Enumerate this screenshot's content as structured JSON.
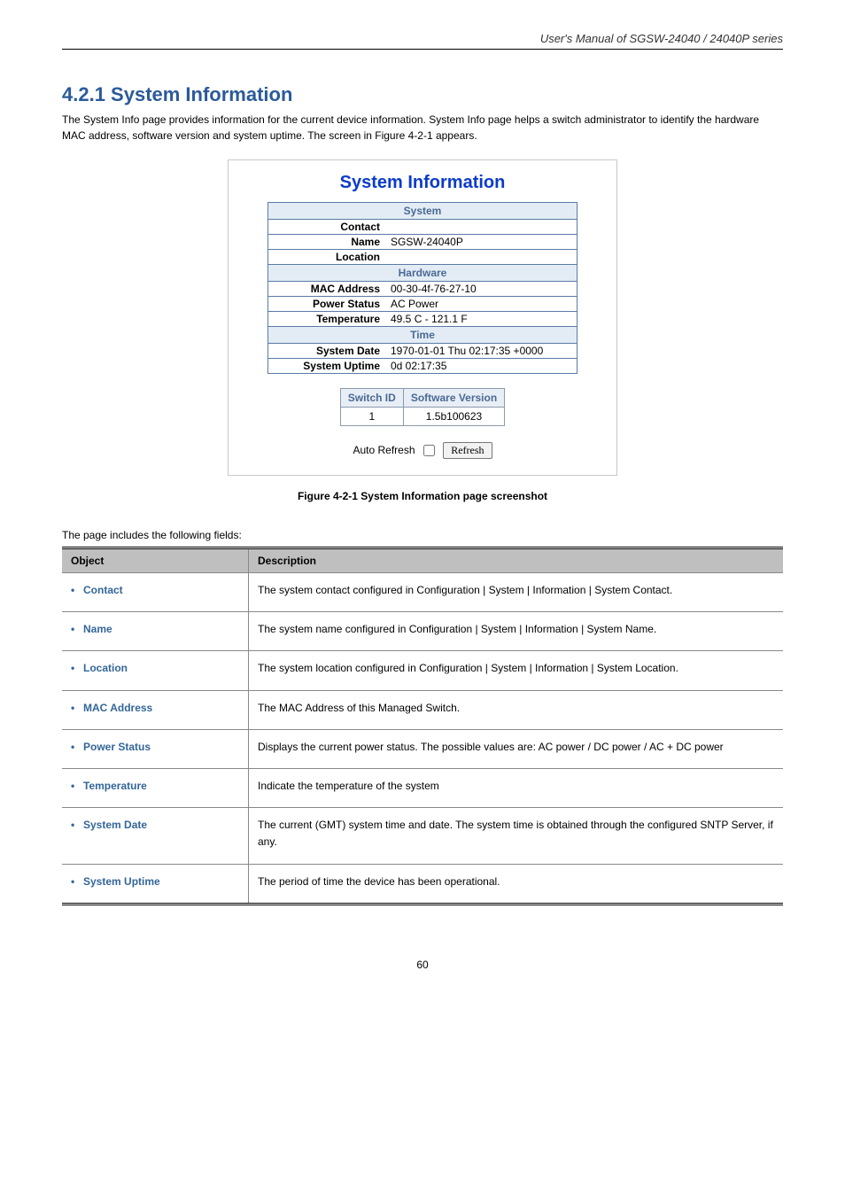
{
  "header": {
    "manual": "User's Manual of SGSW-24040 / 24040P series"
  },
  "section": {
    "title": "4.2.1 System Information",
    "intro": "The System Info page provides information for the current device information. System Info page helps a switch administrator to identify the hardware MAC address, software version and system uptime. The screen in Figure 4-2-1 appears."
  },
  "screenshot": {
    "heading": "System Information",
    "group_system": "System",
    "contact_label": "Contact",
    "contact_value": "",
    "name_label": "Name",
    "name_value": "SGSW-24040P",
    "location_label": "Location",
    "location_value": "",
    "group_hardware": "Hardware",
    "mac_label": "MAC Address",
    "mac_value": "00-30-4f-76-27-10",
    "power_label": "Power Status",
    "power_value": "AC Power",
    "temp_label": "Temperature",
    "temp_value": "49.5 C - 121.1 F",
    "group_time": "Time",
    "date_label": "System Date",
    "date_value": "1970-01-01 Thu 02:17:35 +0000",
    "uptime_label": "System Uptime",
    "uptime_value": "0d 02:17:35",
    "sv_head_switch": "Switch ID",
    "sv_head_soft": "Software Version",
    "sv_row_switch": "1",
    "sv_row_soft": "1.5b100623",
    "auto_refresh_label": "Auto Refresh",
    "refresh_btn": "Refresh"
  },
  "fig_caption": "Figure 4-2-1 System Information page screenshot",
  "after_para": "The page includes the following fields:",
  "desc": {
    "head_object": "Object",
    "head_description": "Description",
    "rows": [
      {
        "obj": "Contact",
        "desc": "The system contact configured in Configuration | System | Information | System Contact."
      },
      {
        "obj": "Name",
        "desc": "The system name configured in Configuration | System | Information | System Name."
      },
      {
        "obj": "Location",
        "desc": "The system location configured in Configuration | System | Information | System Location."
      },
      {
        "obj": "MAC Address",
        "desc": "The MAC Address of this Managed Switch."
      },
      {
        "obj": "Power Status",
        "desc": "Displays the current power status. The possible values are: AC power / DC power / AC + DC power"
      },
      {
        "obj": "Temperature",
        "desc": "Indicate the temperature of the system"
      },
      {
        "obj": "System Date",
        "desc": "The current (GMT) system time and date. The system time is obtained through the configured SNTP Server, if any."
      },
      {
        "obj": "System Uptime",
        "desc": "The period of time the device has been operational."
      }
    ]
  },
  "page_number": "60"
}
